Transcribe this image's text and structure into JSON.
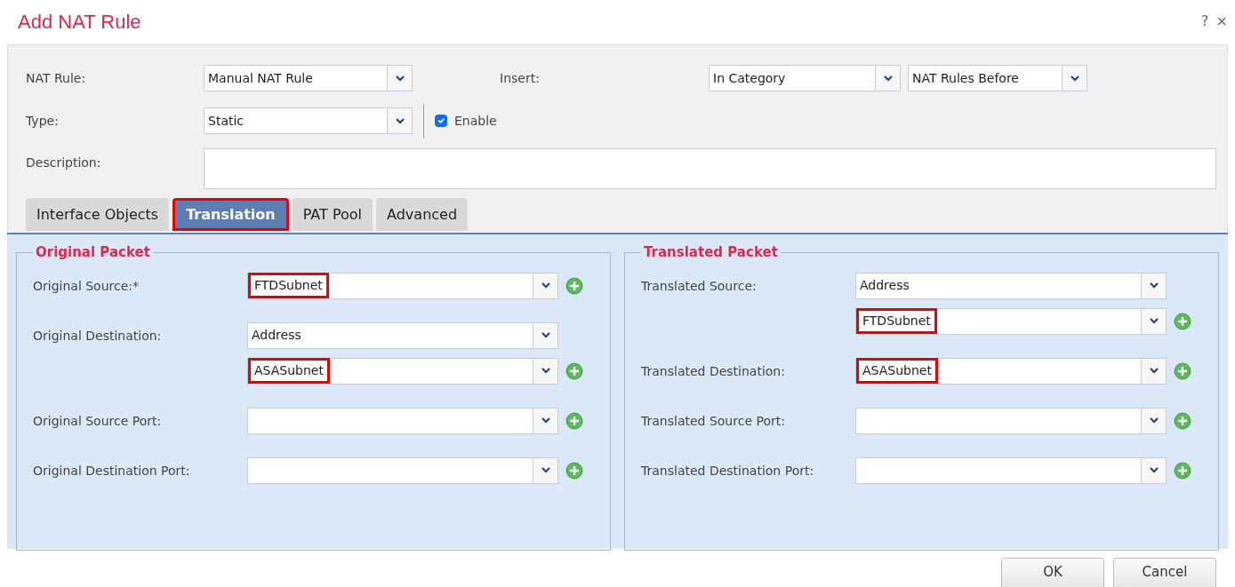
{
  "dialog": {
    "title": "Add NAT Rule",
    "help": "?",
    "close": "×"
  },
  "nat_rule": {
    "label": "NAT Rule:",
    "value": "Manual NAT Rule"
  },
  "insert": {
    "label": "Insert:",
    "values": [
      "In Category",
      "NAT Rules Before"
    ]
  },
  "type": {
    "label": "Type:",
    "value": "Static"
  },
  "enable": {
    "label": "Enable",
    "checked": true
  },
  "description": {
    "label": "Description:"
  },
  "tabs": [
    {
      "label": "Interface Objects",
      "selected": false,
      "highlighted": false
    },
    {
      "label": "Translation",
      "selected": true,
      "highlighted": true
    },
    {
      "label": "PAT Pool",
      "selected": false,
      "highlighted": false
    },
    {
      "label": "Advanced",
      "selected": false,
      "highlighted": false
    }
  ],
  "sections": [
    {
      "title": "Original Packet",
      "rows": [
        {
          "label": "Original Source:*",
          "selects": [
            {
              "value": "FTDSubnet",
              "highlighted": true,
              "add": true
            }
          ]
        },
        {
          "label": "Original Destination:",
          "selects": [
            {
              "value": "Address",
              "highlighted": false,
              "add": false
            },
            {
              "value": "ASASubnet",
              "highlighted": true,
              "add": true
            }
          ]
        },
        {
          "label": "Original Source Port:",
          "selects": [
            {
              "highlighted": false,
              "add": true
            }
          ]
        },
        {
          "label": "Original Destination Port:",
          "selects": [
            {
              "highlighted": false,
              "add": true
            }
          ]
        }
      ]
    },
    {
      "title": "Translated Packet",
      "rows": [
        {
          "label": "Translated Source:",
          "selects": [
            {
              "value": "Address",
              "highlighted": false,
              "add": false
            },
            {
              "value": "FTDSubnet",
              "highlighted": true,
              "add": true
            }
          ]
        },
        {
          "label": "Translated Destination:",
          "selects": [
            {
              "value": "ASASubnet",
              "highlighted": true,
              "add": true
            }
          ]
        },
        {
          "label": "Translated Source Port:",
          "selects": [
            {
              "highlighted": false,
              "add": true
            }
          ]
        },
        {
          "label": "Translated Destination Port:",
          "selects": [
            {
              "highlighted": false,
              "add": true
            }
          ]
        }
      ]
    }
  ],
  "buttons": [
    "OK",
    "Cancel"
  ]
}
